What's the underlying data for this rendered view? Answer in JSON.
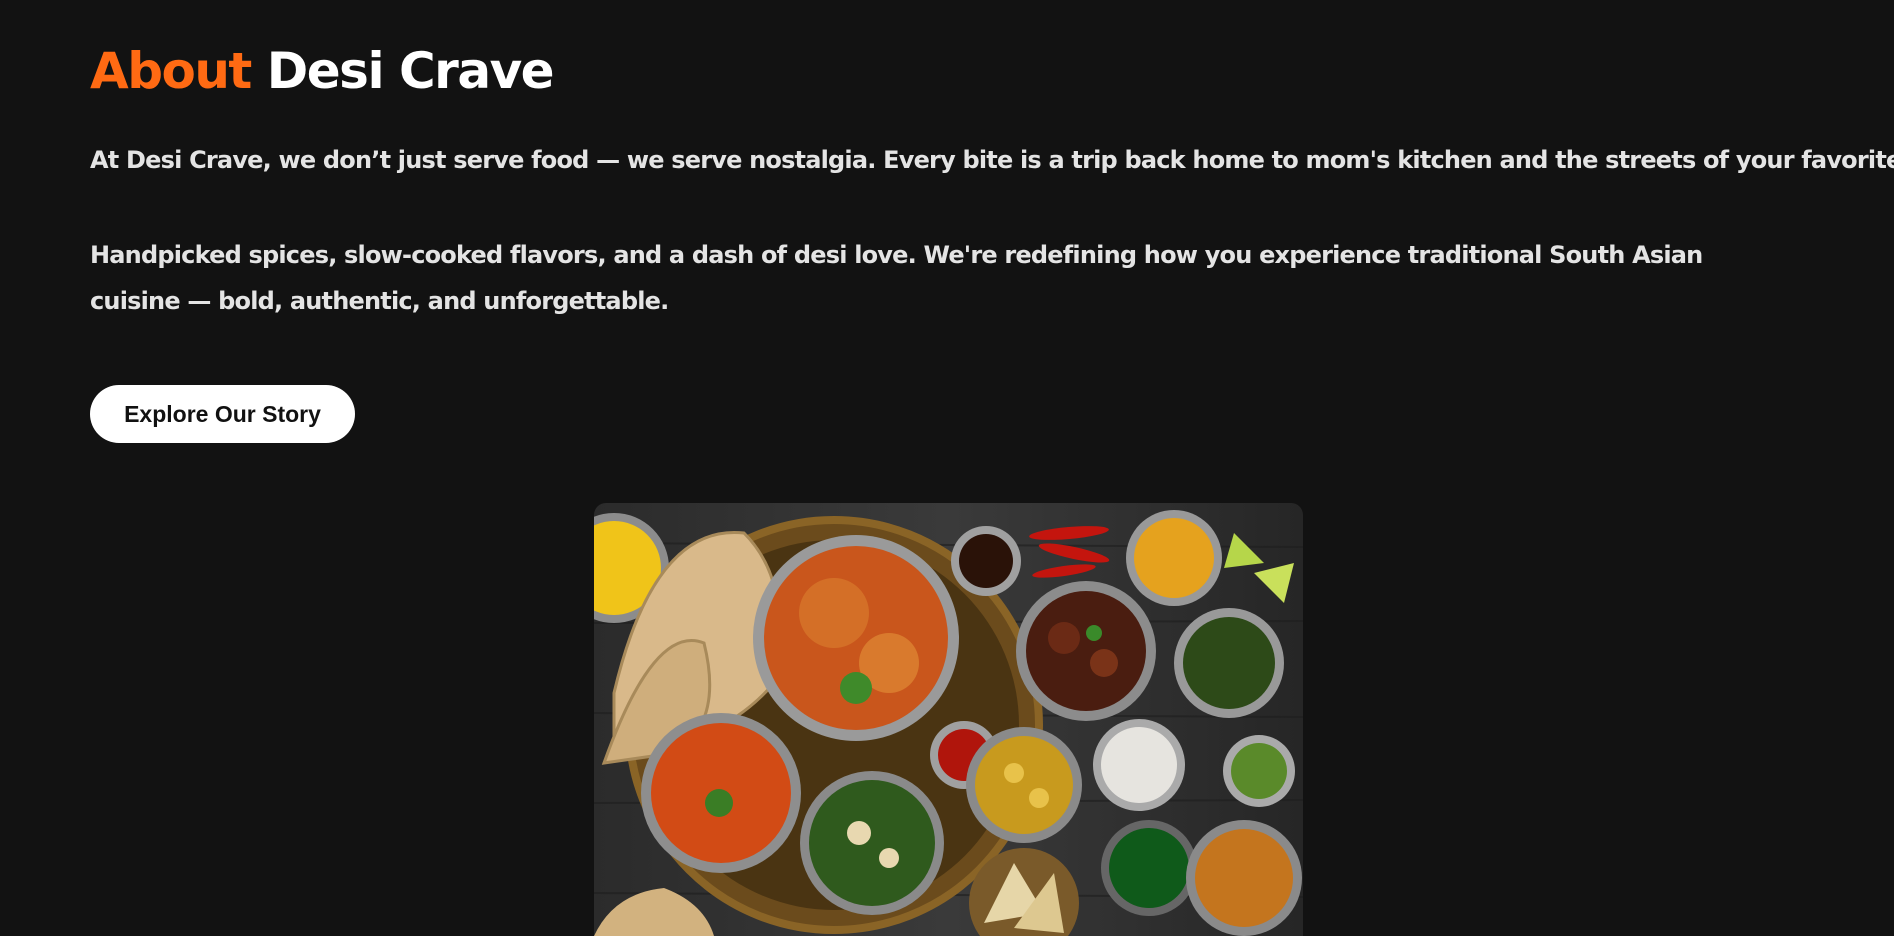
{
  "about": {
    "title_accent": "About",
    "title_rest": "Desi Crave",
    "paragraph_1": "At Desi Crave, we don’t just serve food — we serve nostalgia. Every bite is a trip back home to mom's kitchen and the streets of your favorite city.",
    "paragraph_2": "Handpicked spices, slow-cooked flavors, and a dash of desi love. We're redefining how you experience traditional South Asian cuisine — bold, authentic, and unforgettable.",
    "cta_label": "Explore Our Story"
  },
  "colors": {
    "background": "#121212",
    "accent": "#ff6a13",
    "text": "#e4e4e4",
    "button_bg": "#ffffff",
    "button_text": "#111111"
  }
}
